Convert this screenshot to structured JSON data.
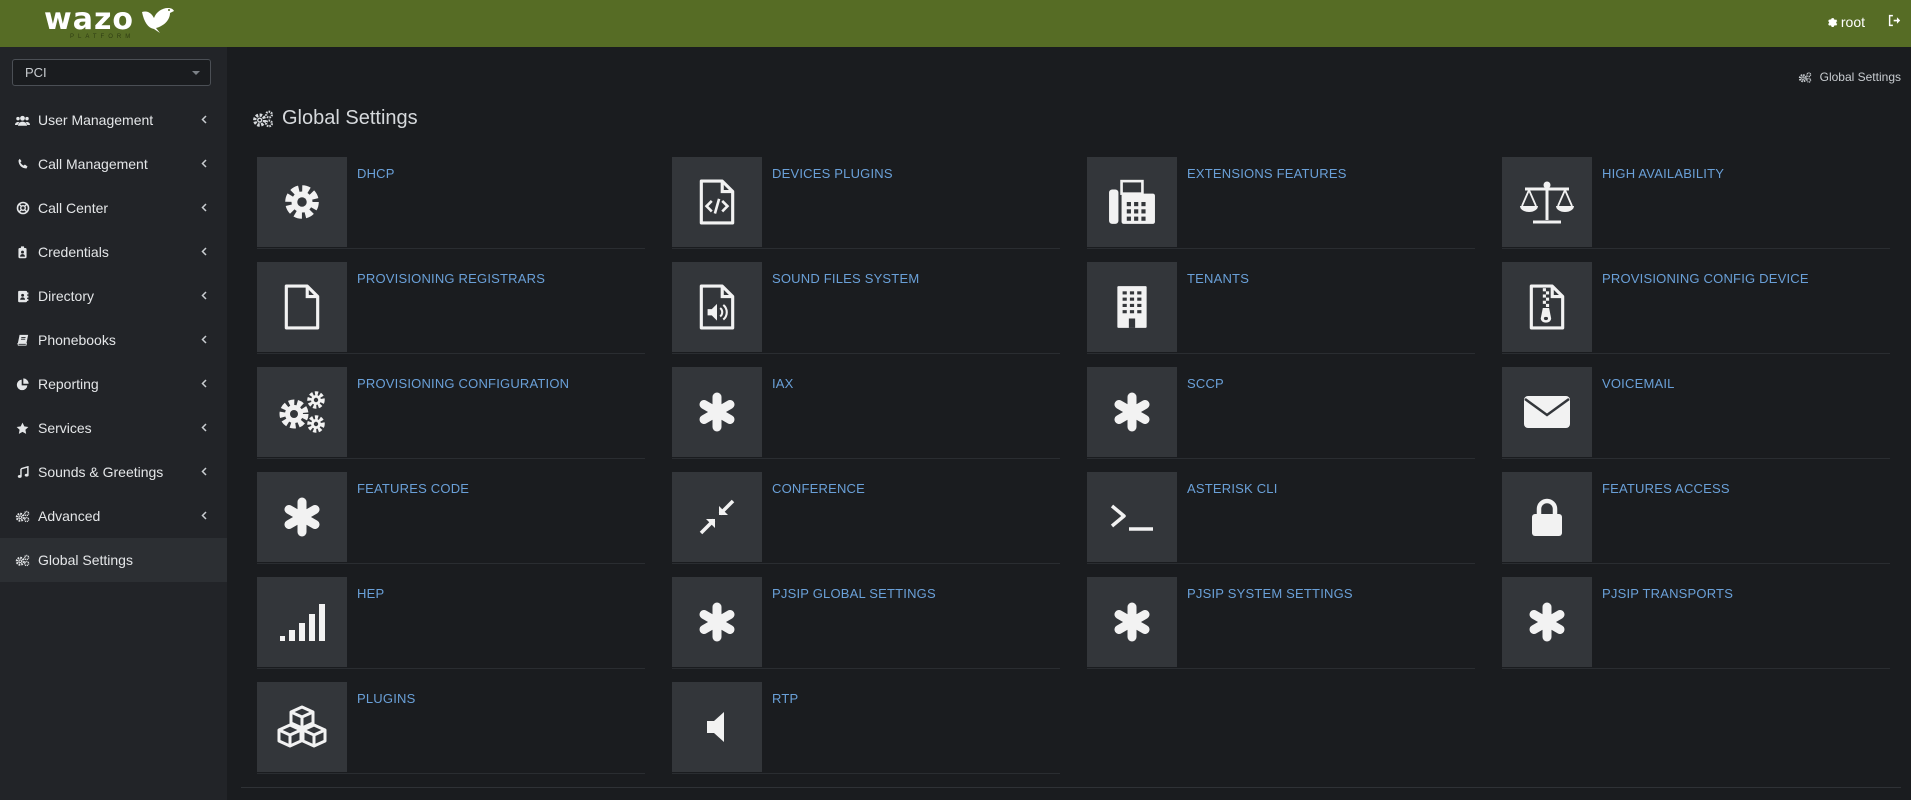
{
  "brand": {
    "name": "wazo",
    "tagline": "PLATFORM"
  },
  "header": {
    "user": "root"
  },
  "sidebar": {
    "tenant": "PCI",
    "items": [
      {
        "label": "User Management",
        "icon": "users-icon"
      },
      {
        "label": "Call Management",
        "icon": "phone-icon"
      },
      {
        "label": "Call Center",
        "icon": "support-icon"
      },
      {
        "label": "Credentials",
        "icon": "id-badge-icon"
      },
      {
        "label": "Directory",
        "icon": "address-book-icon"
      },
      {
        "label": "Phonebooks",
        "icon": "book-icon"
      },
      {
        "label": "Reporting",
        "icon": "pie-chart-icon"
      },
      {
        "label": "Services",
        "icon": "star-icon"
      },
      {
        "label": "Sounds & Greetings",
        "icon": "music-icon"
      },
      {
        "label": "Advanced",
        "icon": "cogs-icon"
      },
      {
        "label": "Global Settings",
        "icon": "cogs-icon"
      }
    ]
  },
  "breadcrumb": "Global Settings",
  "page": {
    "title": "Global Settings"
  },
  "tiles": [
    {
      "label": "DHCP",
      "icon": "gear-icon"
    },
    {
      "label": "DEVICES PLUGINS",
      "icon": "file-code-icon"
    },
    {
      "label": "EXTENSIONS FEATURES",
      "icon": "fax-icon"
    },
    {
      "label": "HIGH AVAILABILITY",
      "icon": "balance-scale-icon"
    },
    {
      "label": "PROVISIONING REGISTRARS",
      "icon": "file-icon"
    },
    {
      "label": "SOUND FILES SYSTEM",
      "icon": "file-audio-icon"
    },
    {
      "label": "TENANTS",
      "icon": "building-icon"
    },
    {
      "label": "PROVISIONING CONFIG DEVICE",
      "icon": "file-archive-icon"
    },
    {
      "label": "PROVISIONING CONFIGURATION",
      "icon": "cogs-icon"
    },
    {
      "label": "IAX",
      "icon": "asterisk-icon"
    },
    {
      "label": "SCCP",
      "icon": "asterisk-icon"
    },
    {
      "label": "VOICEMAIL",
      "icon": "envelope-icon"
    },
    {
      "label": "FEATURES CODE",
      "icon": "asterisk-icon"
    },
    {
      "label": "CONFERENCE",
      "icon": "compress-icon"
    },
    {
      "label": "ASTERISK CLI",
      "icon": "terminal-icon"
    },
    {
      "label": "FEATURES ACCESS",
      "icon": "lock-icon"
    },
    {
      "label": "HEP",
      "icon": "signal-icon"
    },
    {
      "label": "PJSIP GLOBAL SETTINGS",
      "icon": "asterisk-icon"
    },
    {
      "label": "PJSIP SYSTEM SETTINGS",
      "icon": "asterisk-icon"
    },
    {
      "label": "PJSIP TRANSPORTS",
      "icon": "asterisk-icon"
    },
    {
      "label": "PLUGINS",
      "icon": "cubes-icon"
    },
    {
      "label": "RTP",
      "icon": "volume-off-icon"
    }
  ]
}
